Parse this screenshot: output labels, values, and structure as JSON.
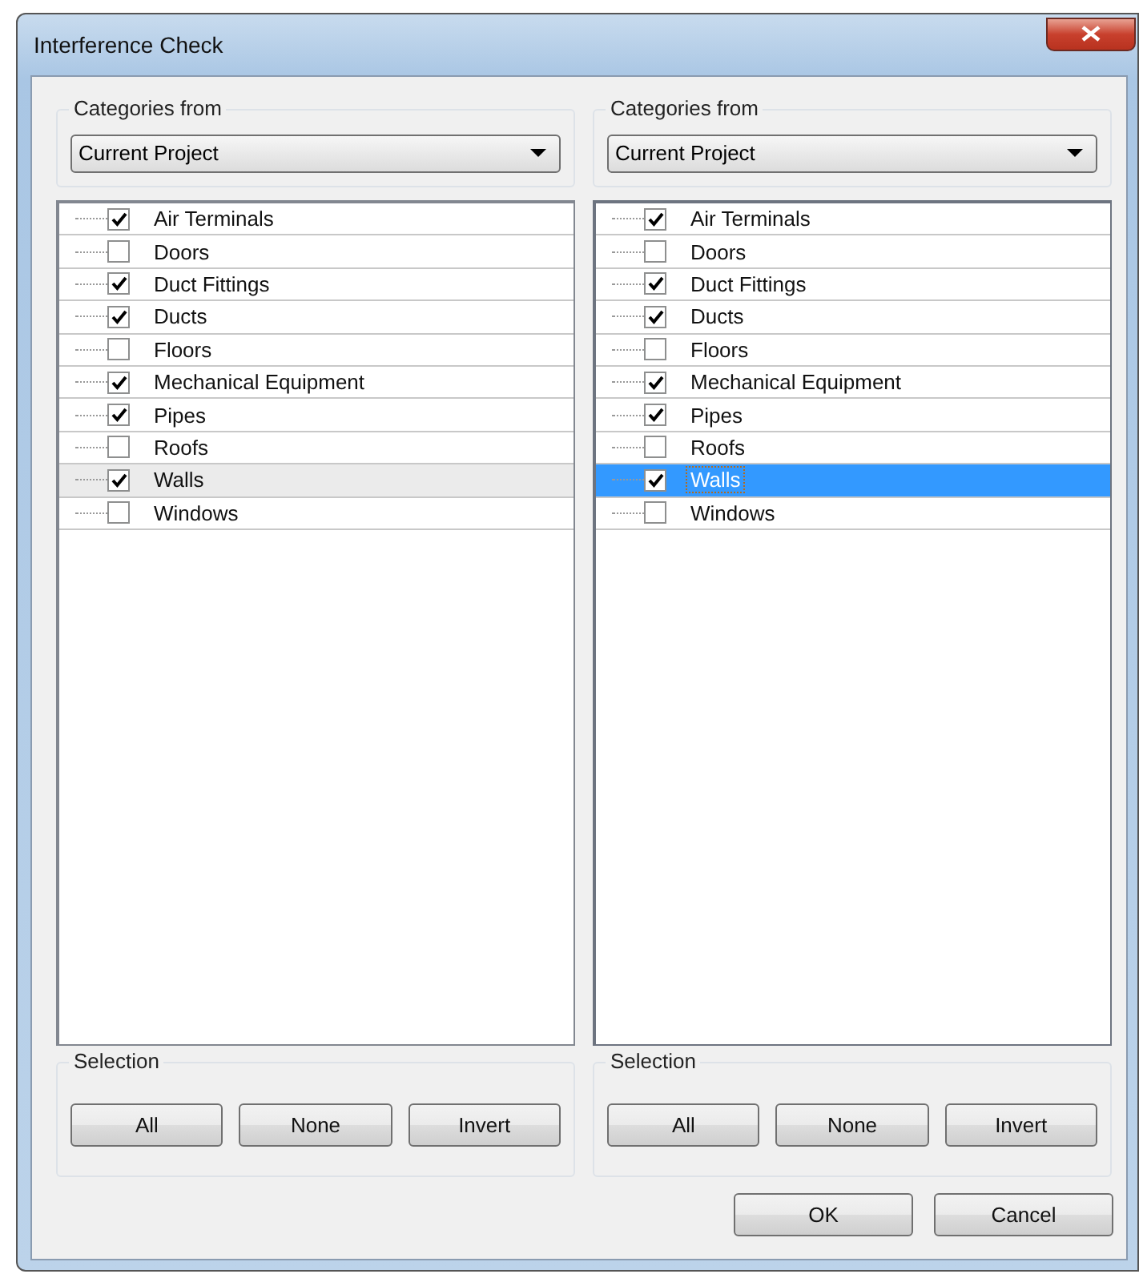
{
  "window": {
    "title": "Interference Check"
  },
  "panes": [
    {
      "focused": false,
      "source_label": "Categories from",
      "source_value": "Current Project",
      "categories": [
        {
          "label": "Air Terminals",
          "checked": true,
          "selected": false
        },
        {
          "label": "Doors",
          "checked": false,
          "selected": false
        },
        {
          "label": "Duct Fittings",
          "checked": true,
          "selected": false
        },
        {
          "label": "Ducts",
          "checked": true,
          "selected": false
        },
        {
          "label": "Floors",
          "checked": false,
          "selected": false
        },
        {
          "label": "Mechanical Equipment",
          "checked": true,
          "selected": false
        },
        {
          "label": "Pipes",
          "checked": true,
          "selected": false
        },
        {
          "label": "Roofs",
          "checked": false,
          "selected": false
        },
        {
          "label": "Walls",
          "checked": true,
          "selected": true
        },
        {
          "label": "Windows",
          "checked": false,
          "selected": false
        }
      ],
      "selection_label": "Selection",
      "selection_buttons": [
        "All",
        "None",
        "Invert"
      ]
    },
    {
      "focused": true,
      "source_label": "Categories from",
      "source_value": "Current Project",
      "categories": [
        {
          "label": "Air Terminals",
          "checked": true,
          "selected": false
        },
        {
          "label": "Doors",
          "checked": false,
          "selected": false
        },
        {
          "label": "Duct Fittings",
          "checked": true,
          "selected": false
        },
        {
          "label": "Ducts",
          "checked": true,
          "selected": false
        },
        {
          "label": "Floors",
          "checked": false,
          "selected": false
        },
        {
          "label": "Mechanical Equipment",
          "checked": true,
          "selected": false
        },
        {
          "label": "Pipes",
          "checked": true,
          "selected": false
        },
        {
          "label": "Roofs",
          "checked": false,
          "selected": false
        },
        {
          "label": "Walls",
          "checked": true,
          "selected": true
        },
        {
          "label": "Windows",
          "checked": false,
          "selected": false
        }
      ],
      "selection_label": "Selection",
      "selection_buttons": [
        "All",
        "None",
        "Invert"
      ]
    }
  ],
  "buttons": [
    "OK",
    "Cancel"
  ]
}
